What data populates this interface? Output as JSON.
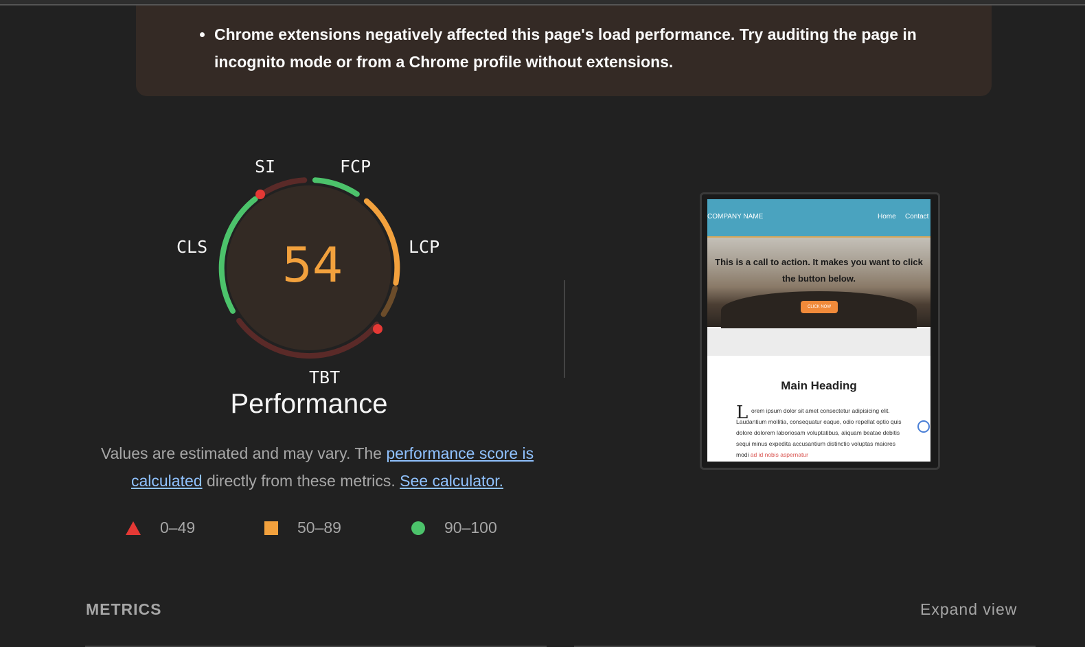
{
  "warning": {
    "text": "Chrome extensions negatively affected this page's load performance. Try auditing the page in incognito mode or from a Chrome profile without extensions."
  },
  "gauge": {
    "score": "54",
    "title": "Performance",
    "metric_labels": {
      "si": "SI",
      "fcp": "FCP",
      "lcp": "LCP",
      "tbt": "TBT",
      "cls": "CLS"
    },
    "colors": {
      "fail": "#e53935",
      "average": "#f2a13d",
      "pass": "#4cc36b",
      "score": "#f2a13d"
    }
  },
  "description": {
    "prefix": "Values are estimated and may vary. The ",
    "link1": "performance score is calculated",
    "middle": " directly from these metrics. ",
    "link2": "See calculator."
  },
  "legend": {
    "fail": "0–49",
    "average": "50–89",
    "pass": "90–100"
  },
  "screenshot": {
    "brand": "COMPANY NAME",
    "nav": [
      "Home",
      "Contact"
    ],
    "cta": "This is a call to action. It makes you want to click the button below.",
    "button": "CLICK NOW",
    "heading": "Main Heading",
    "dropcap": "L",
    "body": "orem ipsum dolor sit amet consectetur adipisicing elit. Laudantium mollitia, consequatur eaque, odio repellat optio quis dolore dolorem laboriosam voluptatibus, aliquam beatae debitis sequi minus expedita accusantium distinctio voluptas maiores modi ",
    "body_highlight": "ad id nobis aspernatur"
  },
  "metrics": {
    "title": "METRICS",
    "expand": "Expand view"
  }
}
